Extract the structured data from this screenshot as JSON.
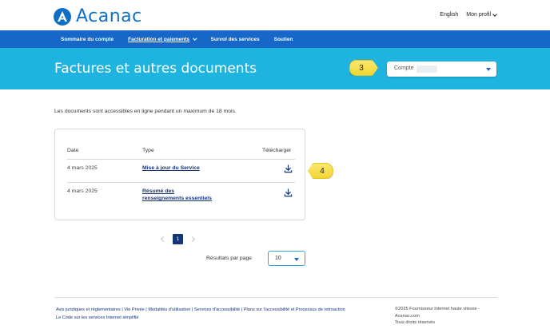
{
  "header": {
    "brand": "Acanac",
    "links": [
      "English",
      "Mon profil"
    ]
  },
  "nav": {
    "items": [
      "Sommaire du compte",
      "Facturation et paiements",
      "Survol des services",
      "Soutien"
    ]
  },
  "banner": {
    "title": "Factures et autres documents",
    "account_label": "Compte"
  },
  "callouts": {
    "c3": "3",
    "c4": "4"
  },
  "main": {
    "intro": "Les documents sont accessibles en ligne pendant un maximum de 18 mois.",
    "table": {
      "headers": [
        "Date",
        "Type",
        "Télécharger"
      ],
      "rows": [
        {
          "date": "4 mars 2025",
          "type_line1": "Mise à jour du Service",
          "type_line2": ""
        },
        {
          "date": "4 mars 2025",
          "type_line1": "Résumé des",
          "type_line2": "renseignements essentiels"
        }
      ]
    },
    "pagination": {
      "current_page": "1"
    },
    "results_per_page": {
      "label": "Résultats par page",
      "value": "10"
    }
  },
  "footer": {
    "links": [
      "Avis juridiques et réglementaires",
      "Vie Privée",
      "Modalités d'utilisation",
      "Services d'accessibilité",
      "Plans sur l'accessibilité et Processus de retroaction",
      "Le Code sur les services Internet simplifié"
    ],
    "copyright_line1": "©2025 Fournisseur Internet haute vitesse -",
    "copyright_line2": "Acanac.com",
    "copyright_line3": "Tous droits réservés"
  },
  "colors": {
    "brand_blue": "#0f6fc6",
    "nav_blue": "#1667c7",
    "banner_cyan": "#1fb3e0",
    "link_navy": "#14357a",
    "callout_yellow": "#f7df44"
  }
}
